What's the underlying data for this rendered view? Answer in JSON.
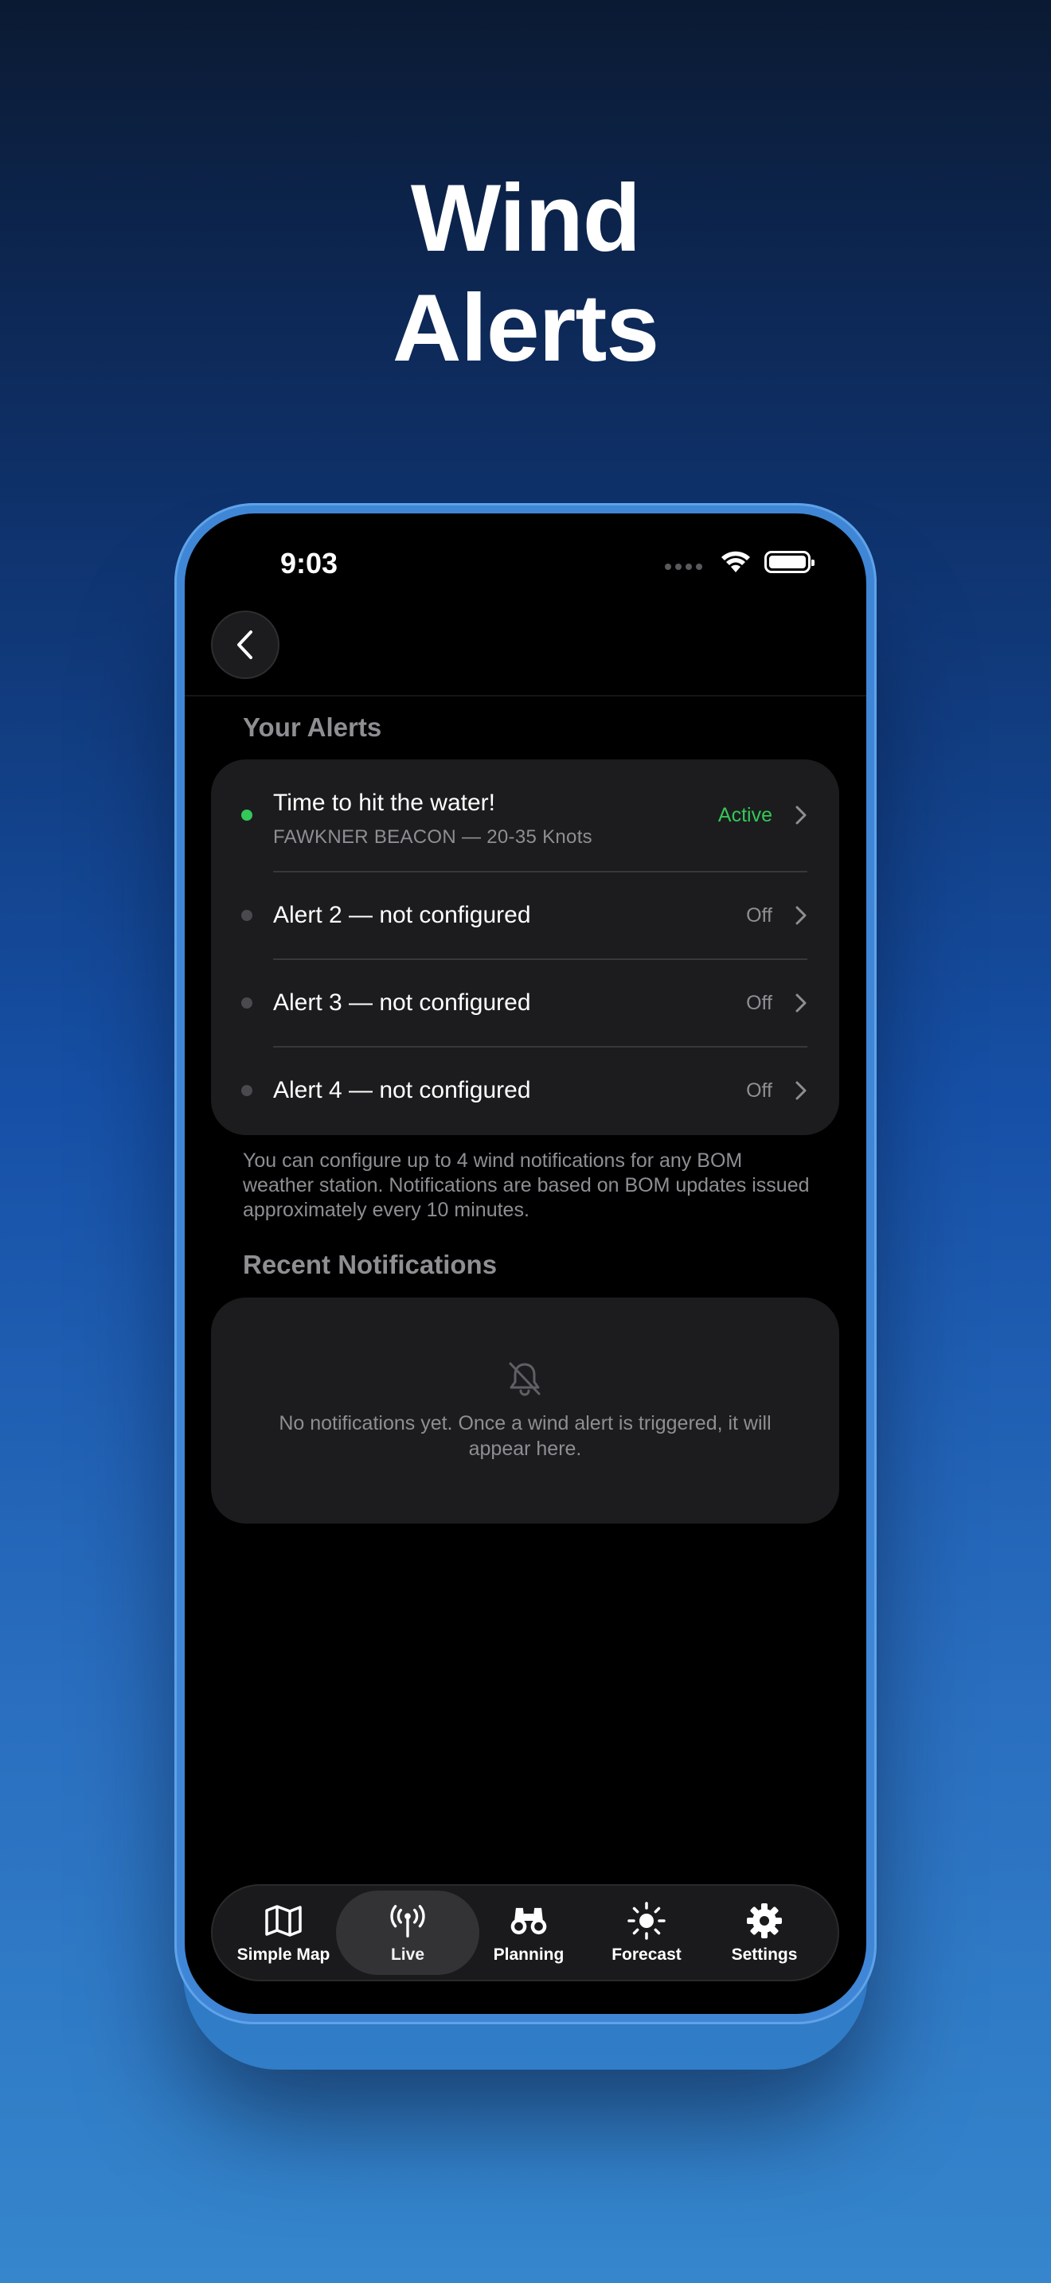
{
  "headline": {
    "line1": "Wind",
    "line2": "Alerts"
  },
  "status_bar": {
    "time": "9:03"
  },
  "alerts_section": {
    "title": "Your Alerts",
    "items": [
      {
        "title": "Time to hit the water!",
        "subtitle": "FAWKNER BEACON — 20-35 Knots",
        "status": "Active",
        "active": true
      },
      {
        "title": "Alert 2 — not configured",
        "status": "Off",
        "active": false
      },
      {
        "title": "Alert 3 — not configured",
        "status": "Off",
        "active": false
      },
      {
        "title": "Alert 4 — not configured",
        "status": "Off",
        "active": false
      }
    ],
    "footnote": "You can configure up to 4 wind notifications for any BOM weather station. Notifications are based on BOM updates issued approximately every 10 minutes."
  },
  "notifications_section": {
    "title": "Recent Notifications",
    "empty_text": "No notifications yet. Once a wind alert is triggered, it will appear here."
  },
  "tabbar": {
    "items": [
      {
        "label": "Simple Map",
        "icon": "map-icon"
      },
      {
        "label": "Live",
        "icon": "antenna-icon",
        "selected": true
      },
      {
        "label": "Planning",
        "icon": "binoculars-icon"
      },
      {
        "label": "Forecast",
        "icon": "sun-icon"
      },
      {
        "label": "Settings",
        "icon": "gear-icon"
      }
    ]
  },
  "colors": {
    "active_green": "#34c759",
    "frame_blue": "#3f86d6",
    "card_bg": "#1c1c1e"
  }
}
